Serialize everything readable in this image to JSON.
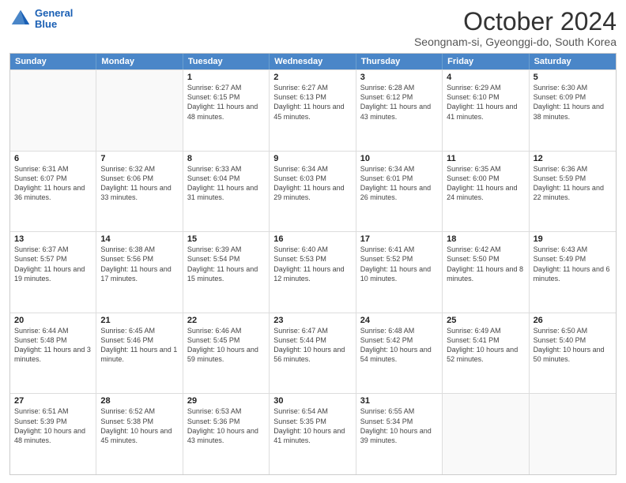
{
  "header": {
    "logo_line1": "General",
    "logo_line2": "Blue",
    "title": "October 2024",
    "subtitle": "Seongnam-si, Gyeonggi-do, South Korea"
  },
  "days_of_week": [
    "Sunday",
    "Monday",
    "Tuesday",
    "Wednesday",
    "Thursday",
    "Friday",
    "Saturday"
  ],
  "weeks": [
    [
      {
        "day": "",
        "empty": true
      },
      {
        "day": "",
        "empty": true
      },
      {
        "day": "1",
        "sunrise": "6:27 AM",
        "sunset": "6:15 PM",
        "daylight": "11 hours and 48 minutes."
      },
      {
        "day": "2",
        "sunrise": "6:27 AM",
        "sunset": "6:13 PM",
        "daylight": "11 hours and 45 minutes."
      },
      {
        "day": "3",
        "sunrise": "6:28 AM",
        "sunset": "6:12 PM",
        "daylight": "11 hours and 43 minutes."
      },
      {
        "day": "4",
        "sunrise": "6:29 AM",
        "sunset": "6:10 PM",
        "daylight": "11 hours and 41 minutes."
      },
      {
        "day": "5",
        "sunrise": "6:30 AM",
        "sunset": "6:09 PM",
        "daylight": "11 hours and 38 minutes."
      }
    ],
    [
      {
        "day": "6",
        "sunrise": "6:31 AM",
        "sunset": "6:07 PM",
        "daylight": "11 hours and 36 minutes."
      },
      {
        "day": "7",
        "sunrise": "6:32 AM",
        "sunset": "6:06 PM",
        "daylight": "11 hours and 33 minutes."
      },
      {
        "day": "8",
        "sunrise": "6:33 AM",
        "sunset": "6:04 PM",
        "daylight": "11 hours and 31 minutes."
      },
      {
        "day": "9",
        "sunrise": "6:34 AM",
        "sunset": "6:03 PM",
        "daylight": "11 hours and 29 minutes."
      },
      {
        "day": "10",
        "sunrise": "6:34 AM",
        "sunset": "6:01 PM",
        "daylight": "11 hours and 26 minutes."
      },
      {
        "day": "11",
        "sunrise": "6:35 AM",
        "sunset": "6:00 PM",
        "daylight": "11 hours and 24 minutes."
      },
      {
        "day": "12",
        "sunrise": "6:36 AM",
        "sunset": "5:59 PM",
        "daylight": "11 hours and 22 minutes."
      }
    ],
    [
      {
        "day": "13",
        "sunrise": "6:37 AM",
        "sunset": "5:57 PM",
        "daylight": "11 hours and 19 minutes."
      },
      {
        "day": "14",
        "sunrise": "6:38 AM",
        "sunset": "5:56 PM",
        "daylight": "11 hours and 17 minutes."
      },
      {
        "day": "15",
        "sunrise": "6:39 AM",
        "sunset": "5:54 PM",
        "daylight": "11 hours and 15 minutes."
      },
      {
        "day": "16",
        "sunrise": "6:40 AM",
        "sunset": "5:53 PM",
        "daylight": "11 hours and 12 minutes."
      },
      {
        "day": "17",
        "sunrise": "6:41 AM",
        "sunset": "5:52 PM",
        "daylight": "11 hours and 10 minutes."
      },
      {
        "day": "18",
        "sunrise": "6:42 AM",
        "sunset": "5:50 PM",
        "daylight": "11 hours and 8 minutes."
      },
      {
        "day": "19",
        "sunrise": "6:43 AM",
        "sunset": "5:49 PM",
        "daylight": "11 hours and 6 minutes."
      }
    ],
    [
      {
        "day": "20",
        "sunrise": "6:44 AM",
        "sunset": "5:48 PM",
        "daylight": "11 hours and 3 minutes."
      },
      {
        "day": "21",
        "sunrise": "6:45 AM",
        "sunset": "5:46 PM",
        "daylight": "11 hours and 1 minute."
      },
      {
        "day": "22",
        "sunrise": "6:46 AM",
        "sunset": "5:45 PM",
        "daylight": "10 hours and 59 minutes."
      },
      {
        "day": "23",
        "sunrise": "6:47 AM",
        "sunset": "5:44 PM",
        "daylight": "10 hours and 56 minutes."
      },
      {
        "day": "24",
        "sunrise": "6:48 AM",
        "sunset": "5:42 PM",
        "daylight": "10 hours and 54 minutes."
      },
      {
        "day": "25",
        "sunrise": "6:49 AM",
        "sunset": "5:41 PM",
        "daylight": "10 hours and 52 minutes."
      },
      {
        "day": "26",
        "sunrise": "6:50 AM",
        "sunset": "5:40 PM",
        "daylight": "10 hours and 50 minutes."
      }
    ],
    [
      {
        "day": "27",
        "sunrise": "6:51 AM",
        "sunset": "5:39 PM",
        "daylight": "10 hours and 48 minutes."
      },
      {
        "day": "28",
        "sunrise": "6:52 AM",
        "sunset": "5:38 PM",
        "daylight": "10 hours and 45 minutes."
      },
      {
        "day": "29",
        "sunrise": "6:53 AM",
        "sunset": "5:36 PM",
        "daylight": "10 hours and 43 minutes."
      },
      {
        "day": "30",
        "sunrise": "6:54 AM",
        "sunset": "5:35 PM",
        "daylight": "10 hours and 41 minutes."
      },
      {
        "day": "31",
        "sunrise": "6:55 AM",
        "sunset": "5:34 PM",
        "daylight": "10 hours and 39 minutes."
      },
      {
        "day": "",
        "empty": true
      },
      {
        "day": "",
        "empty": true
      }
    ]
  ],
  "labels": {
    "sunrise": "Sunrise:",
    "sunset": "Sunset:",
    "daylight": "Daylight:"
  }
}
